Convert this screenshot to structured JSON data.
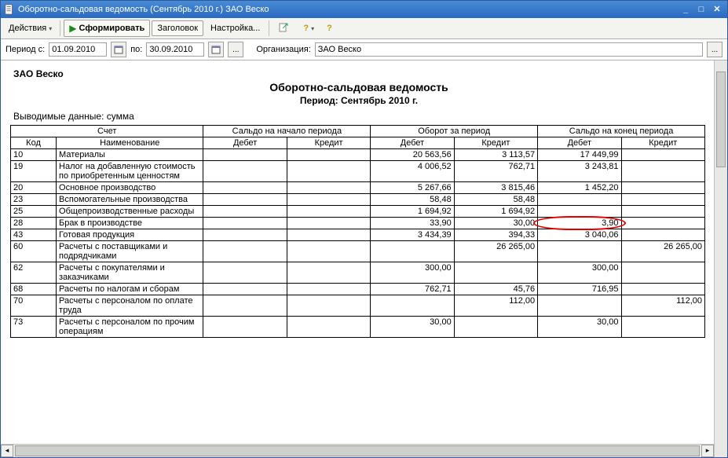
{
  "window": {
    "title": "Оборотно-сальдовая ведомость (Сентябрь 2010 г.) ЗАО Веско"
  },
  "menu": {
    "actions": "Действия"
  },
  "toolbar": {
    "form": "Сформировать",
    "header": "Заголовок",
    "settings": "Настройка..."
  },
  "filter": {
    "period_from_label": "Период с:",
    "from": "01.09.2010",
    "to_label": "по:",
    "to": "30.09.2010",
    "spread": "...",
    "org_label": "Организация:",
    "org": "ЗАО Веско"
  },
  "report": {
    "org": "ЗАО Веско",
    "title": "Оборотно-сальдовая ведомость",
    "subtitle": "Период: Сентябрь 2010 г.",
    "display": "Выводимые данные: сумма",
    "hdr": {
      "acct": "Счет",
      "code": "Код",
      "name": "Наименование",
      "open": "Сальдо на начало периода",
      "turn": "Оборот за период",
      "close": "Сальдо на конец периода",
      "debit": "Дебет",
      "credit": "Кредит"
    }
  },
  "rows": [
    {
      "code": "10",
      "name": "Материалы",
      "od": "",
      "oc": "",
      "td": "20 563,56",
      "tc": "3 113,57",
      "cd": "17 449,99",
      "cc": ""
    },
    {
      "code": "19",
      "name": "Налог на добавленную стоимость по приобретенным ценностям",
      "od": "",
      "oc": "",
      "td": "4 006,52",
      "tc": "762,71",
      "cd": "3 243,81",
      "cc": ""
    },
    {
      "code": "20",
      "name": "Основное производство",
      "od": "",
      "oc": "",
      "td": "5 267,66",
      "tc": "3 815,46",
      "cd": "1 452,20",
      "cc": ""
    },
    {
      "code": "23",
      "name": "Вспомогательные производства",
      "od": "",
      "oc": "",
      "td": "58,48",
      "tc": "58,48",
      "cd": "",
      "cc": ""
    },
    {
      "code": "25",
      "name": "Общепроизводственные расходы",
      "od": "",
      "oc": "",
      "td": "1 694,92",
      "tc": "1 694,92",
      "cd": "",
      "cc": ""
    },
    {
      "code": "28",
      "name": "Брак в производстве",
      "od": "",
      "oc": "",
      "td": "33,90",
      "tc": "30,00",
      "cd": "3,90",
      "cc": "",
      "highlight": true
    },
    {
      "code": "43",
      "name": "Готовая продукция",
      "od": "",
      "oc": "",
      "td": "3 434,39",
      "tc": "394,33",
      "cd": "3 040,06",
      "cc": ""
    },
    {
      "code": "60",
      "name": "Расчеты с поставщиками и подрядчиками",
      "od": "",
      "oc": "",
      "td": "",
      "tc": "26 265,00",
      "cd": "",
      "cc": "26 265,00"
    },
    {
      "code": "62",
      "name": "Расчеты с покупателями и заказчиками",
      "od": "",
      "oc": "",
      "td": "300,00",
      "tc": "",
      "cd": "300,00",
      "cc": ""
    },
    {
      "code": "68",
      "name": "Расчеты по налогам и сборам",
      "od": "",
      "oc": "",
      "td": "762,71",
      "tc": "45,76",
      "cd": "716,95",
      "cc": ""
    },
    {
      "code": "70",
      "name": "Расчеты с персоналом по оплате труда",
      "od": "",
      "oc": "",
      "td": "",
      "tc": "112,00",
      "cd": "",
      "cc": "112,00"
    },
    {
      "code": "73",
      "name": "Расчеты с персоналом по прочим операциям",
      "od": "",
      "oc": "",
      "td": "30,00",
      "tc": "",
      "cd": "30,00",
      "cc": ""
    }
  ],
  "chart_data": {
    "type": "table",
    "title": "Оборотно-сальдовая ведомость — Период: Сентябрь 2010 г.",
    "columns": [
      "Код",
      "Наименование",
      "Сальдо начало Дебет",
      "Сальдо начало Кредит",
      "Оборот Дебет",
      "Оборот Кредит",
      "Сальдо конец Дебет",
      "Сальдо конец Кредит"
    ],
    "rows": [
      [
        "10",
        "Материалы",
        null,
        null,
        20563.56,
        3113.57,
        17449.99,
        null
      ],
      [
        "19",
        "Налог на добавленную стоимость по приобретенным ценностям",
        null,
        null,
        4006.52,
        762.71,
        3243.81,
        null
      ],
      [
        "20",
        "Основное производство",
        null,
        null,
        5267.66,
        3815.46,
        1452.2,
        null
      ],
      [
        "23",
        "Вспомогательные производства",
        null,
        null,
        58.48,
        58.48,
        null,
        null
      ],
      [
        "25",
        "Общепроизводственные расходы",
        null,
        null,
        1694.92,
        1694.92,
        null,
        null
      ],
      [
        "28",
        "Брак в производстве",
        null,
        null,
        33.9,
        30.0,
        3.9,
        null
      ],
      [
        "43",
        "Готовая продукция",
        null,
        null,
        3434.39,
        394.33,
        3040.06,
        null
      ],
      [
        "60",
        "Расчеты с поставщиками и подрядчиками",
        null,
        null,
        null,
        26265.0,
        null,
        26265.0
      ],
      [
        "62",
        "Расчеты с покупателями и заказчиками",
        null,
        null,
        300.0,
        null,
        300.0,
        null
      ],
      [
        "68",
        "Расчеты по налогам и сборам",
        null,
        null,
        762.71,
        45.76,
        716.95,
        null
      ],
      [
        "70",
        "Расчеты с персоналом по оплате труда",
        null,
        null,
        null,
        112.0,
        null,
        112.0
      ],
      [
        "73",
        "Расчеты с персоналом по прочим операциям",
        null,
        null,
        30.0,
        null,
        30.0,
        null
      ]
    ]
  }
}
